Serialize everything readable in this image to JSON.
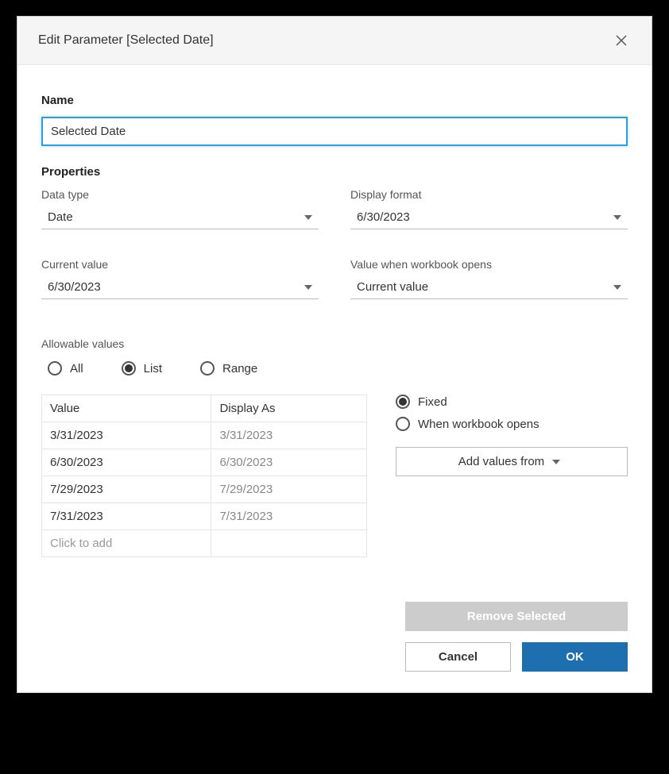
{
  "title": "Edit Parameter [Selected Date]",
  "name_section_label": "Name",
  "name_value": "Selected Date",
  "properties_label": "Properties",
  "props": {
    "data_type": {
      "label": "Data type",
      "value": "Date"
    },
    "display_format": {
      "label": "Display format",
      "value": "6/30/2023"
    },
    "current_value": {
      "label": "Current value",
      "value": "6/30/2023"
    },
    "value_when_open": {
      "label": "Value when workbook opens",
      "value": "Current value"
    }
  },
  "allowable": {
    "label": "Allowable values",
    "options": {
      "all": "All",
      "list": "List",
      "range": "Range"
    }
  },
  "table": {
    "header_value": "Value",
    "header_display": "Display As",
    "rows": [
      {
        "value": "3/31/2023",
        "display": "3/31/2023"
      },
      {
        "value": "6/30/2023",
        "display": "6/30/2023"
      },
      {
        "value": "7/29/2023",
        "display": "7/29/2023"
      },
      {
        "value": "7/31/2023",
        "display": "7/31/2023"
      }
    ],
    "add_placeholder": "Click to add"
  },
  "right": {
    "fixed": "Fixed",
    "when_open": "When workbook opens",
    "add_values": "Add values from"
  },
  "footer": {
    "remove": "Remove Selected",
    "cancel": "Cancel",
    "ok": "OK"
  }
}
